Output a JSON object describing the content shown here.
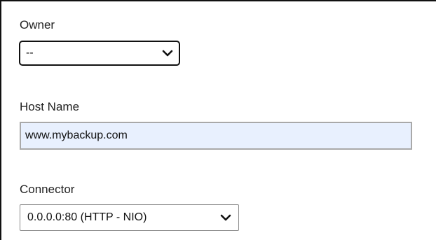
{
  "form": {
    "owner": {
      "label": "Owner",
      "selected": "--"
    },
    "host_name": {
      "label": "Host Name",
      "value": "www.mybackup.com"
    },
    "connector": {
      "label": "Connector",
      "selected": "0.0.0.0:80 (HTTP - NIO)"
    }
  },
  "icons": {
    "dropdown": "chevron-down-icon"
  },
  "colors": {
    "autofill_background": "#e8f0fe"
  }
}
